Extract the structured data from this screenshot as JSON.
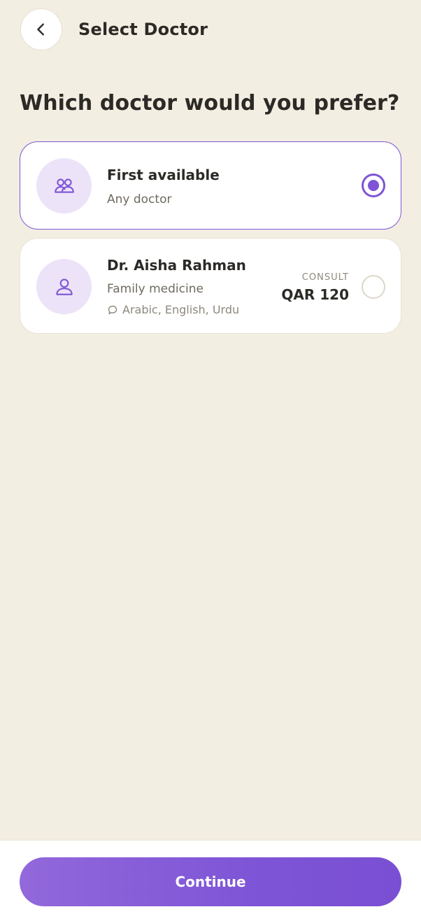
{
  "header": {
    "title": "Select Doctor",
    "back_icon": "chevron-left-icon"
  },
  "question": "Which doctor would you prefer?",
  "options": [
    {
      "title": "First available",
      "subtitle": "Any doctor",
      "icon": "users-icon",
      "selected": true
    },
    {
      "title": "Dr. Aisha Rahman",
      "subtitle": "Family medicine",
      "languages": "Arabic, English, Urdu",
      "consult_label": "CONSULT",
      "price": "QAR 120",
      "icon": "user-icon",
      "selected": false
    }
  ],
  "footer": {
    "continue_label": "Continue"
  },
  "colors": {
    "background": "#F3EEE2",
    "accent": "#7E55D6",
    "avatar_bg": "#EDE3F8"
  }
}
